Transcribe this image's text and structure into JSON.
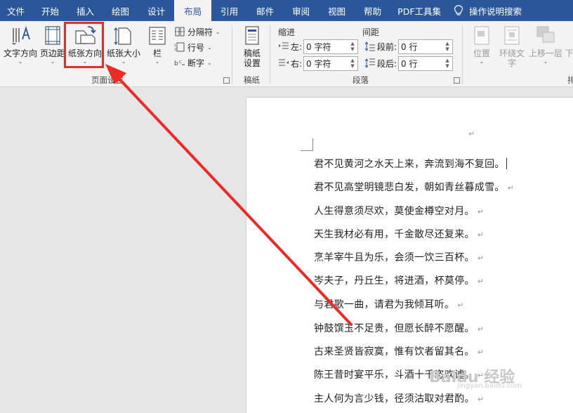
{
  "tabs": [
    "文件",
    "开始",
    "插入",
    "绘图",
    "设计",
    "布局",
    "引用",
    "邮件",
    "审阅",
    "视图",
    "帮助",
    "PDF工具集"
  ],
  "active_tab": "布局",
  "tell_me": "操作说明搜索",
  "page_setup": {
    "text_direction": "文字方向",
    "margins": "页边距",
    "orientation": "纸张方向",
    "size": "纸张大小",
    "columns": "栏",
    "breaks": "分隔符",
    "line_numbers": "行号",
    "hyphenation": "断字",
    "group_label": "页面设置"
  },
  "draft": {
    "button": "稿纸设置",
    "button_line1": "稿纸",
    "button_line2": "设置",
    "group_label": "稿纸"
  },
  "paragraph": {
    "indent_header": "缩进",
    "spacing_header": "间距",
    "left_label": "左:",
    "right_label": "右:",
    "before_label": "段前:",
    "after_label": "段后:",
    "left_value": "0 字符",
    "right_value": "0 字符",
    "before_value": "0 行",
    "after_value": "0 行",
    "group_label": "段落"
  },
  "arrange": {
    "position": "位置",
    "wrap_line1": "环绕文",
    "wrap_line2": "字",
    "forward": "上移一层",
    "backward": "下",
    "group_label": "排"
  },
  "document": {
    "lines": [
      "君不见黄河之水天上来，奔流到海不复回。",
      "君不见高堂明镜悲白发，朝如青丝暮成雪。",
      "人生得意须尽欢，莫使金樽空对月。",
      "天生我材必有用，千金散尽还复来。",
      "烹羊宰牛且为乐，会须一饮三百杯。",
      "岑夫子，丹丘生，将进酒，杯莫停。",
      "与君歌一曲，请君为我倾耳听。",
      "钟鼓馔玉不足贵，但愿长醉不愿醒。",
      "古来圣贤皆寂寞，惟有饮者留其名。",
      "陈王昔时宴平乐，斗酒十千恣欢谑。",
      "主人何为言少钱，径须沽取对君酌。"
    ],
    "paragraph_mark": "↵"
  },
  "watermark": {
    "main": "Baidu 经验",
    "sub": "jingyan.baidu.com"
  },
  "colors": {
    "accent": "#2b579a",
    "highlight": "#ee2a24",
    "ribbon_bg": "#f3f3f3"
  },
  "icons": [
    "lightbulb-icon",
    "text-direction-icon",
    "margins-icon",
    "orientation-icon",
    "size-icon",
    "columns-icon",
    "breaks-icon",
    "line-numbers-icon",
    "hyphenation-icon",
    "draft-icon",
    "indent-left-icon",
    "indent-right-icon",
    "spacing-before-icon",
    "spacing-after-icon",
    "position-icon",
    "wrap-text-icon",
    "bring-forward-icon"
  ]
}
